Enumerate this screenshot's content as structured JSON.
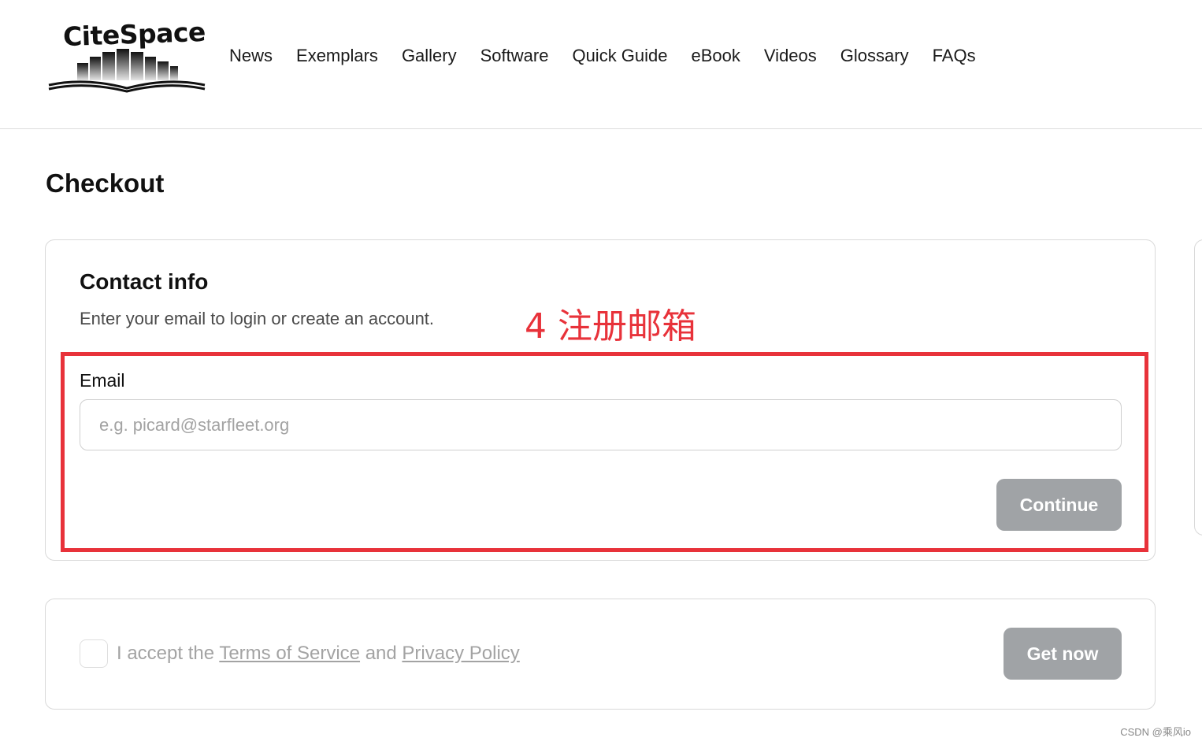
{
  "brand": {
    "logo_text": "CiteSpace"
  },
  "nav": {
    "items": [
      {
        "label": "News"
      },
      {
        "label": "Exemplars"
      },
      {
        "label": "Gallery"
      },
      {
        "label": "Software"
      },
      {
        "label": "Quick Guide"
      },
      {
        "label": "eBook"
      },
      {
        "label": "Videos"
      },
      {
        "label": "Glossary"
      },
      {
        "label": "FAQs"
      }
    ]
  },
  "page": {
    "title": "Checkout"
  },
  "contact": {
    "title": "Contact info",
    "subtitle": "Enter your email to login or create an account.",
    "email_label": "Email",
    "email_placeholder": "e.g. picard@starfleet.org",
    "email_value": "",
    "continue_label": "Continue"
  },
  "annotation": {
    "text": "4 注册邮箱",
    "color": "#e8323a"
  },
  "terms": {
    "prefix": "I accept the",
    "terms_link": "Terms of Service",
    "middle": "and",
    "privacy_link": "Privacy Policy",
    "checked": false,
    "get_now_label": "Get now"
  },
  "colors": {
    "button_disabled": "#a0a3a6",
    "annotation": "#e8323a"
  },
  "watermark": "CSDN @乘风io"
}
